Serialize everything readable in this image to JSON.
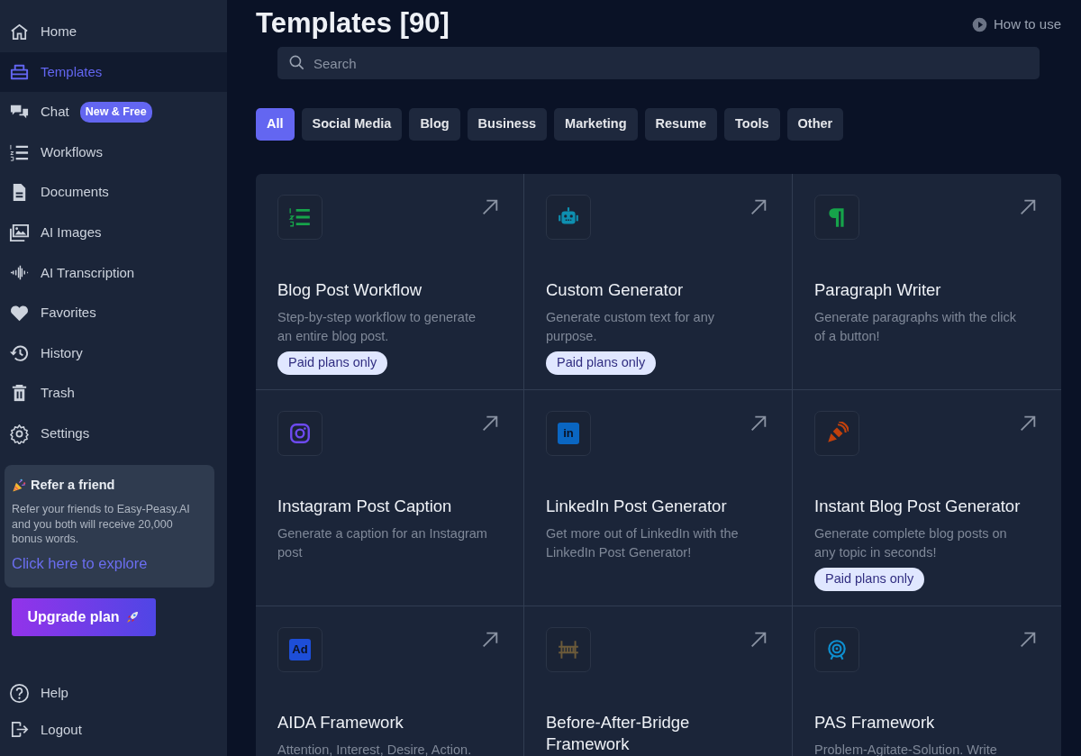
{
  "sidebar": {
    "items": [
      {
        "label": "Home",
        "kind": "home",
        "selected": false
      },
      {
        "label": "Templates",
        "kind": "templates",
        "selected": true
      },
      {
        "label": "Chat",
        "kind": "chat",
        "selected": false,
        "badge": "New & Free"
      },
      {
        "label": "Workflows",
        "kind": "workflows",
        "selected": false
      },
      {
        "label": "Documents",
        "kind": "document",
        "selected": false
      },
      {
        "label": "AI Images",
        "kind": "images",
        "selected": false
      },
      {
        "label": "AI Transcription",
        "kind": "wave",
        "selected": false
      },
      {
        "label": "Favorites",
        "kind": "heart",
        "selected": false
      },
      {
        "label": "History",
        "kind": "history",
        "selected": false
      },
      {
        "label": "Trash",
        "kind": "trash",
        "selected": false
      },
      {
        "label": "Settings",
        "kind": "gear",
        "selected": false
      }
    ],
    "refer": {
      "title": "Refer a friend",
      "text": "Refer your friends to Easy-Peasy.AI and you both will receive 20,000 bonus words.",
      "link": "Click here to explore"
    },
    "upgrade_button": "Upgrade plan",
    "bottom_items": [
      {
        "label": "Help",
        "kind": "help"
      },
      {
        "label": "Logout",
        "kind": "logout"
      }
    ]
  },
  "header": {
    "title": "Templates [90]",
    "how_to_use": "How to use"
  },
  "search": {
    "placeholder": "Search"
  },
  "filters": [
    {
      "label": "All",
      "selected": true
    },
    {
      "label": "Social Media",
      "selected": false
    },
    {
      "label": "Blog",
      "selected": false
    },
    {
      "label": "Business",
      "selected": false
    },
    {
      "label": "Marketing",
      "selected": false
    },
    {
      "label": "Resume",
      "selected": false
    },
    {
      "label": "Tools",
      "selected": false
    },
    {
      "label": "Other",
      "selected": false
    }
  ],
  "templates": [
    {
      "title": "Blog Post Workflow",
      "description": "Step-by-step workflow to generate an entire blog post.",
      "kind": "list",
      "badge": "Paid plans only"
    },
    {
      "title": "Custom Generator",
      "description": "Generate custom text for any purpose.",
      "kind": "robot",
      "badge": "Paid plans only"
    },
    {
      "title": "Paragraph Writer",
      "description": "Generate paragraphs with the click of a button!",
      "kind": "paragraph"
    },
    {
      "title": "Instagram Post Caption",
      "description": "Generate a caption for an Instagram post",
      "kind": "camera"
    },
    {
      "title": "LinkedIn Post Generator",
      "description": "Get more out of LinkedIn with the LinkedIn Post Generator!",
      "kind": "tile",
      "icon_text": "in"
    },
    {
      "title": "Instant Blog Post Generator",
      "description": "Generate complete blog posts on any topic in seconds!",
      "kind": "pen",
      "badge": "Paid plans only"
    },
    {
      "title": "AIDA Framework",
      "description": "Attention, Interest, Desire, Action.",
      "kind": "tile",
      "icon_text": "Ad"
    },
    {
      "title": "Before-After-Bridge Framework",
      "kind": "bridge"
    },
    {
      "title": "PAS Framework",
      "description": "Problem-Agitate-Solution. Write",
      "kind": "target"
    }
  ]
}
